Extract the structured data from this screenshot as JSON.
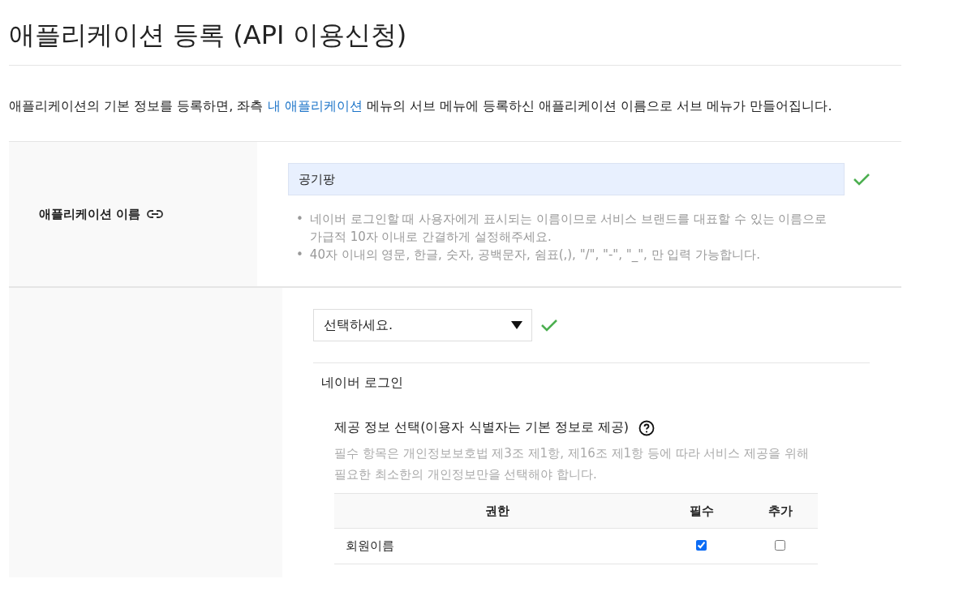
{
  "title": "애플리케이션 등록 (API 이용신청)",
  "intro": {
    "before": "애플리케이션의 기본 정보를 등록하면, 좌측 ",
    "link": "내 애플리케이션",
    "after": " 메뉴의 서브 메뉴에 등록하신 애플리케이션 이름으로 서브 메뉴가 만들어집니다."
  },
  "app_name": {
    "label": "애플리케이션 이름",
    "value": "공기팡",
    "valid": true,
    "hints": [
      {
        "marker": "•",
        "text": "네이버 로그인할 때 사용자에게 표시되는 이름이므로 서비스 브랜드를 대표할 수 있는 이름으로 가급적 10자 이내로 간결하게 설정해주세요."
      },
      {
        "marker": "•",
        "text": "40자 이내의 영문, 한글, 숫자, 공백문자, 쉼표(,), \"/\", \"-\", \"_\", 만 입력 가능합니다."
      }
    ]
  },
  "api_select": {
    "value": "선택하세요.",
    "valid": true
  },
  "section": {
    "title": "네이버 로그인",
    "subtitle": "제공 정보 선택(이용자 식별자는 기본 정보로 제공)",
    "description": "필수 항목은 개인정보보호법 제3조 제1항, 제16조 제1항 등에 따라 서비스 제공을 위해 필요한 최소한의 개인정보만을 선택해야 합니다."
  },
  "table": {
    "columns": [
      "권한",
      "필수",
      "추가"
    ],
    "rows": [
      {
        "name": "회원이름",
        "required": true,
        "additional": false
      }
    ]
  }
}
